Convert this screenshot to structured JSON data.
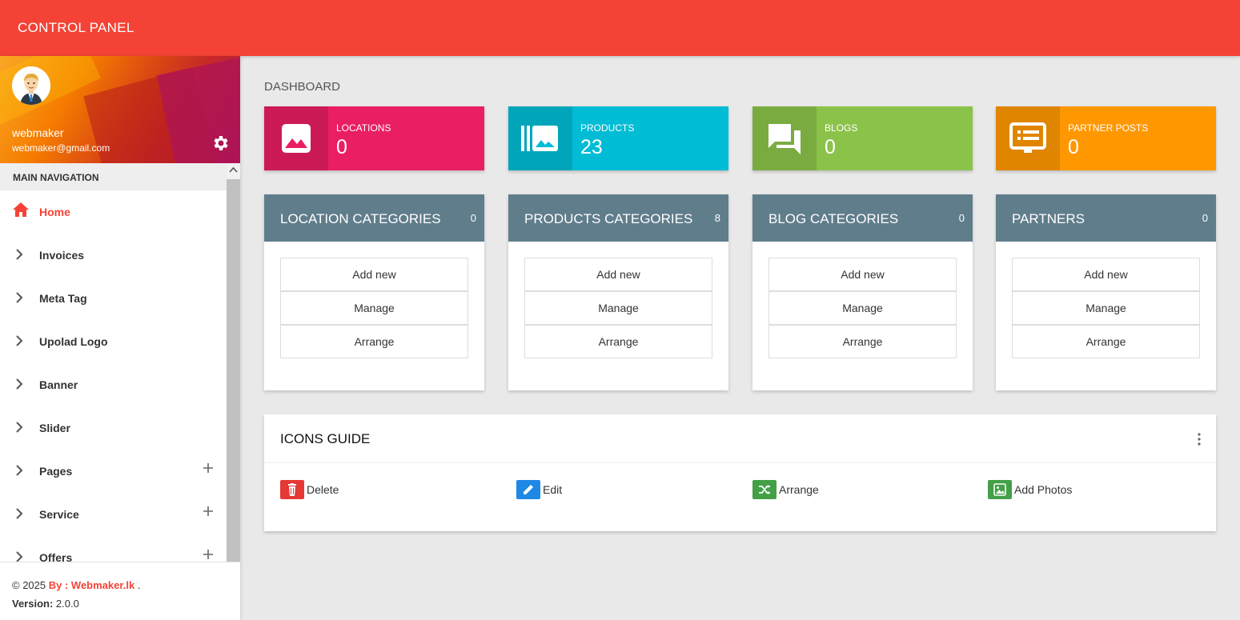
{
  "app": {
    "title": "CONTROL PANEL"
  },
  "user": {
    "name": "webmaker",
    "email": "webmaker@gmail.com"
  },
  "nav": {
    "header": "MAIN NAVIGATION",
    "items": [
      {
        "label": "Home",
        "icon": "home-icon",
        "active": true
      },
      {
        "label": "Invoices",
        "icon": "chevron-right-icon"
      },
      {
        "label": "Meta Tag",
        "icon": "chevron-right-icon"
      },
      {
        "label": "Upolad Logo",
        "icon": "chevron-right-icon"
      },
      {
        "label": "Banner",
        "icon": "chevron-right-icon"
      },
      {
        "label": "Slider",
        "icon": "chevron-right-icon"
      },
      {
        "label": "Pages",
        "icon": "chevron-right-icon",
        "expandable": true
      },
      {
        "label": "Service",
        "icon": "chevron-right-icon",
        "expandable": true
      },
      {
        "label": "Offers",
        "icon": "chevron-right-icon",
        "expandable": true
      }
    ]
  },
  "footer": {
    "copyright": "© 2025",
    "link": "By : Webmaker.lk",
    "dot": ".",
    "version_label": "Version:",
    "version": "2.0.0"
  },
  "page": {
    "title": "DASHBOARD"
  },
  "stats": [
    {
      "label": "LOCATIONS",
      "value": "0",
      "color": "#e91e63",
      "icon": "image-icon"
    },
    {
      "label": "PRODUCTS",
      "value": "23",
      "color": "#00bcd4",
      "icon": "gallery-icon"
    },
    {
      "label": "BLOGS",
      "value": "0",
      "color": "#8bc34a",
      "icon": "forum-icon"
    },
    {
      "label": "PARTNER POSTS",
      "value": "0",
      "color": "#ff9800",
      "icon": "monitor-list-icon"
    }
  ],
  "cards": [
    {
      "title": "LOCATION CATEGORIES",
      "count": "0",
      "actions": [
        "Add new",
        "Manage",
        "Arrange"
      ]
    },
    {
      "title": "PRODUCTS CATEGORIES",
      "count": "8",
      "actions": [
        "Add new",
        "Manage",
        "Arrange"
      ]
    },
    {
      "title": "BLOG CATEGORIES",
      "count": "0",
      "actions": [
        "Add new",
        "Manage",
        "Arrange"
      ]
    },
    {
      "title": "PARTNERS",
      "count": "0",
      "actions": [
        "Add new",
        "Manage",
        "Arrange"
      ]
    }
  ],
  "icons_guide": {
    "title": "ICONS GUIDE",
    "items": [
      {
        "label": "Delete",
        "color": "#e53935",
        "icon": "trash-icon"
      },
      {
        "label": "Edit",
        "color": "#1e88e5",
        "icon": "pencil-icon"
      },
      {
        "label": "Arrange",
        "color": "#43a047",
        "icon": "shuffle-icon"
      },
      {
        "label": "Add Photos",
        "color": "#43a047",
        "icon": "photo-icon"
      }
    ]
  }
}
